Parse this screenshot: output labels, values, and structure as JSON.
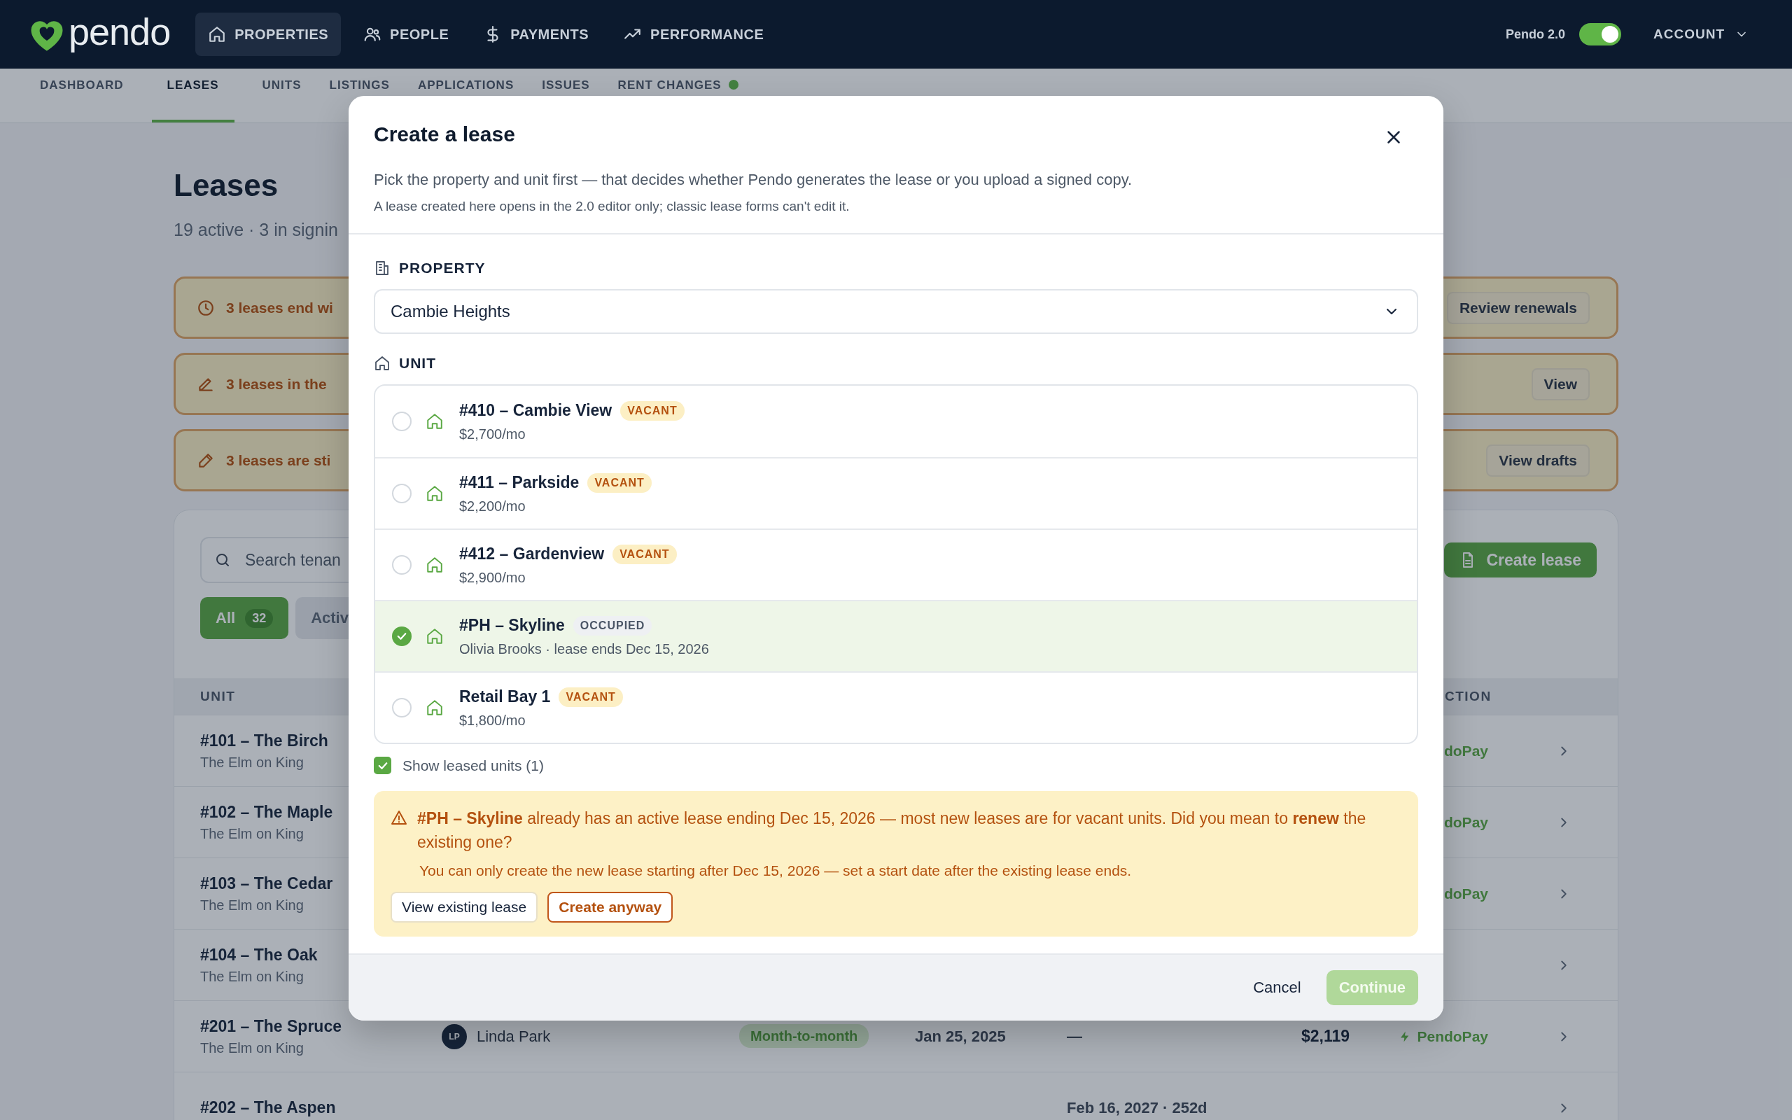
{
  "top_nav": {
    "logo": "pendo",
    "items": [
      {
        "label": "PROPERTIES",
        "selected": true
      },
      {
        "label": "PEOPLE",
        "selected": false
      },
      {
        "label": "PAYMENTS",
        "selected": false
      },
      {
        "label": "PERFORMANCE",
        "selected": false
      }
    ],
    "version_toggle": {
      "label": "Pendo 2.0",
      "on": true
    },
    "account": "ACCOUNT"
  },
  "sub_nav": {
    "tabs": [
      {
        "label": "DASHBOARD",
        "selected": false,
        "dot": false
      },
      {
        "label": "LEASES",
        "selected": true,
        "dot": false
      },
      {
        "label": "UNITS",
        "selected": false,
        "dot": false
      },
      {
        "label": "LISTINGS",
        "selected": false,
        "dot": false
      },
      {
        "label": "APPLICATIONS",
        "selected": false,
        "dot": false
      },
      {
        "label": "ISSUES",
        "selected": false,
        "dot": false
      },
      {
        "label": "RENT CHANGES",
        "selected": false,
        "dot": true
      }
    ]
  },
  "page": {
    "title": "Leases",
    "subtitle": "19 active · 3 in signin",
    "alerts": [
      {
        "kind": "clock",
        "text": "3 leases end wi",
        "action": "Review renewals"
      },
      {
        "kind": "pen",
        "text": "3 leases in the",
        "action": "View"
      },
      {
        "kind": "pencil",
        "text": "3 leases are sti",
        "action": "View drafts"
      }
    ],
    "search": {
      "placeholder": "Search tenan"
    },
    "create_button": "Create lease",
    "filters": [
      {
        "label": "All",
        "count": "32",
        "selected": true
      },
      {
        "label": "Activ",
        "selected": false
      }
    ],
    "table": {
      "columns": [
        "UNIT",
        "CTION"
      ],
      "rows": [
        {
          "unit": "#101 – The Birch",
          "property": "The Elm on King",
          "payment": "doPay"
        },
        {
          "unit": "#102 – The Maple",
          "property": "The Elm on King",
          "payment": "doPay"
        },
        {
          "unit": "#103 – The Cedar",
          "property": "The Elm on King",
          "payment": "doPay"
        },
        {
          "unit": "#104 – The Oak",
          "property": "The Elm on King"
        },
        {
          "unit": "#201 – The Spruce",
          "property": "The Elm on King",
          "initials": "LP",
          "tenant": "Linda Park",
          "term": "Month-to-month",
          "start": "Jan 25, 2025",
          "end": "—",
          "rent": "$2,119",
          "payment": "PendoPay",
          "bolt": true
        },
        {
          "unit": "#202 – The Aspen",
          "end": "Feb 16, 2027 · 252d"
        }
      ]
    }
  },
  "modal": {
    "title": "Create a lease",
    "description": "Pick the property and unit first — that decides whether Pendo generates the lease or you upload a signed copy.",
    "note": "A lease created here opens in the 2.0 editor only; classic lease forms can't edit it.",
    "property": {
      "label": "PROPERTY",
      "value": "Cambie Heights"
    },
    "unit": {
      "label": "UNIT",
      "options": [
        {
          "title": "#410 – Cambie View",
          "status": "VACANT",
          "kind": "vacant",
          "detail": "$2,700/mo",
          "selected": false
        },
        {
          "title": "#411 – Parkside",
          "status": "VACANT",
          "kind": "vacant",
          "detail": "$2,200/mo",
          "selected": false
        },
        {
          "title": "#412 – Gardenview",
          "status": "VACANT",
          "kind": "vacant",
          "detail": "$2,900/mo",
          "selected": false
        },
        {
          "title": "#PH – Skyline",
          "status": "OCCUPIED",
          "kind": "occupied",
          "detail": "Olivia Brooks · lease ends Dec 15, 2026",
          "selected": true
        },
        {
          "title": "Retail Bay 1",
          "status": "VACANT",
          "kind": "vacant",
          "detail": "$1,800/mo",
          "selected": false
        }
      ]
    },
    "show_leased": {
      "label": "Show leased units (1)",
      "checked": true
    },
    "warning": {
      "message": "**#PH – Skyline** already has an active lease ending Dec 15, 2026 — most new leases are for vacant units. Did you mean to **renew** the existing one?",
      "detail": "You can only create the new lease starting after Dec 15, 2026 — set a start date after the existing lease ends.",
      "actions": [
        {
          "label": "View existing lease",
          "kind": "secondary"
        },
        {
          "label": "Create anyway",
          "kind": "primary"
        }
      ]
    },
    "footer": {
      "cancel": "Cancel",
      "continue": {
        "label": "Continue",
        "disabled": true
      }
    }
  }
}
